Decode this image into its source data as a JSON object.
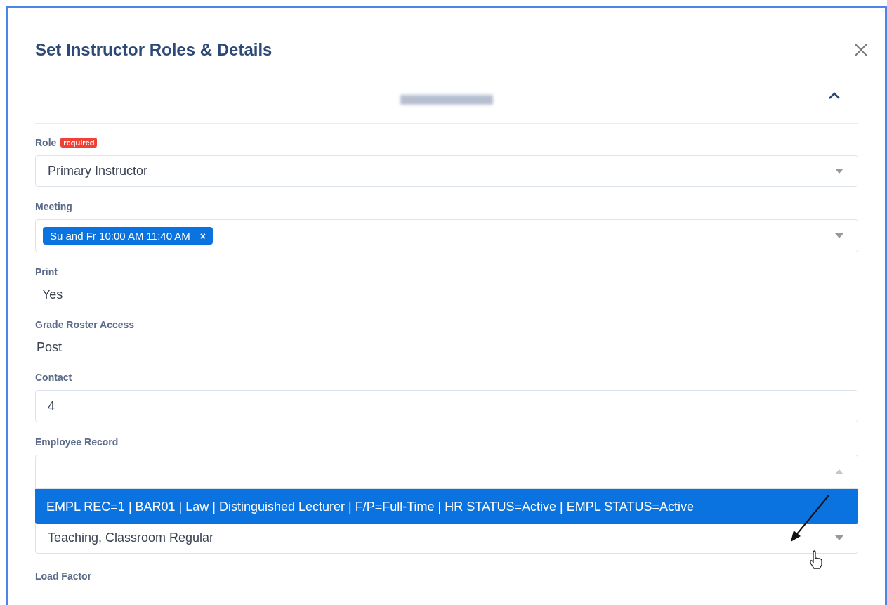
{
  "dialog": {
    "title": "Set Instructor Roles & Details"
  },
  "section": {
    "expanded": true
  },
  "fields": [
    {
      "kind": "select",
      "label": "Role",
      "badge": "required",
      "value": "Primary Instructor"
    },
    {
      "kind": "tags",
      "label": "Meeting",
      "tags": [
        "Su and Fr 10:00 AM 11:40 AM"
      ],
      "remove": "×"
    },
    {
      "kind": "static",
      "label": "Print",
      "value": "Yes"
    },
    {
      "kind": "static",
      "label": "Grade Roster Access",
      "value": "Post"
    },
    {
      "kind": "input",
      "label": "Contact",
      "value": "4"
    },
    {
      "kind": "open",
      "label": "Employee Record",
      "options": [
        {
          "label": "EMPL REC=1 | BAR01 | Law | Distinguished Lecturer | F/P=Full-Time | HR STATUS=Active | EMPL STATUS=Active",
          "selected": true
        }
      ]
    },
    {
      "kind": "select",
      "value": "Teaching, Classroom Regular"
    },
    {
      "kind": "label",
      "label": "Load Factor"
    }
  ]
}
